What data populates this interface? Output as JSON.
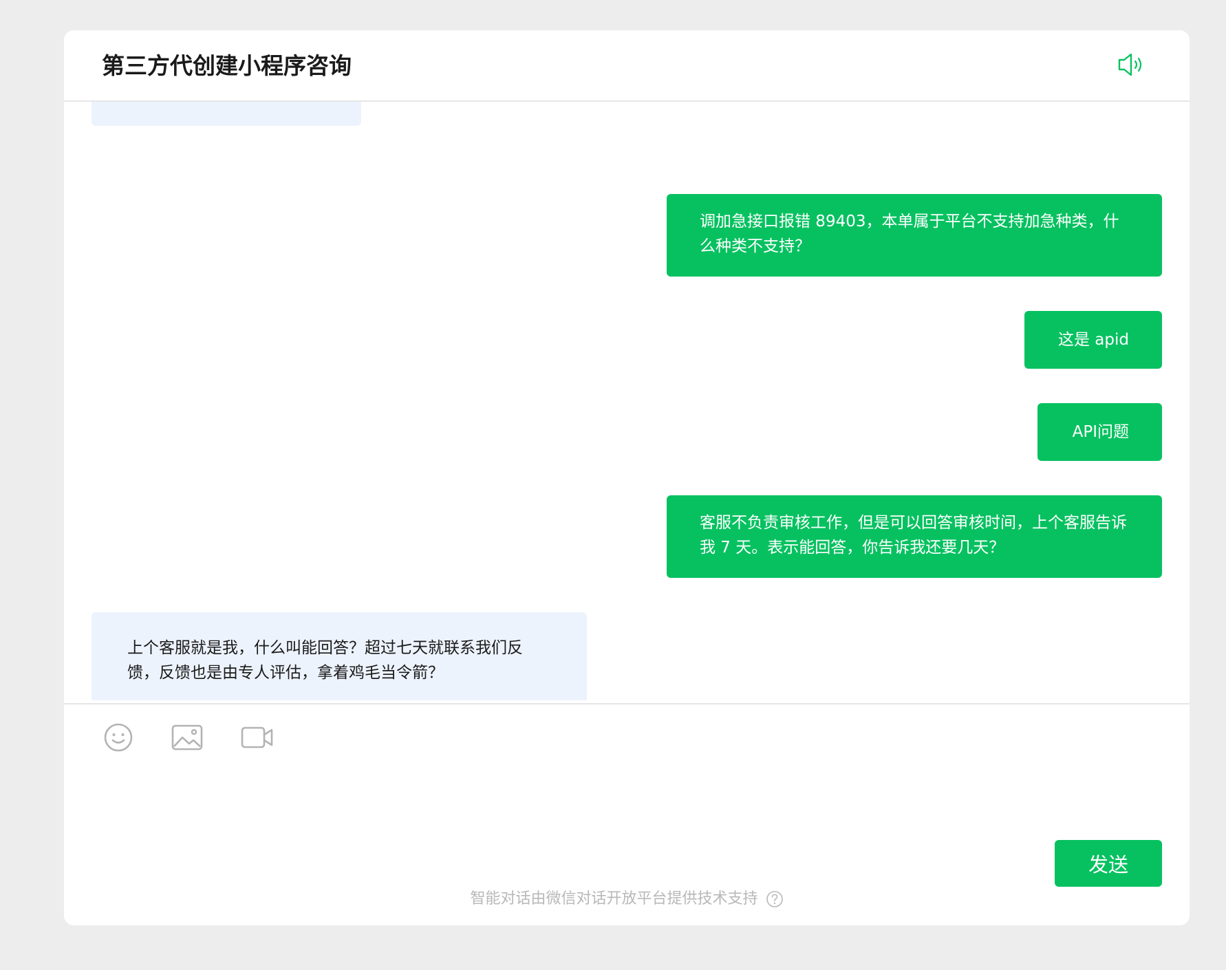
{
  "header": {
    "title": "第三方代创建小程序咨询",
    "speaker_icon": "speaker-icon"
  },
  "messages": [
    {
      "role": "user",
      "text": "调加急接口报错 89403，本单属于平台不支持加急种类，什么种类不支持？"
    },
    {
      "role": "user",
      "text": "这是 apid"
    },
    {
      "role": "user",
      "text": "API问题"
    },
    {
      "role": "user",
      "text": "客服不负责审核工作，但是可以回答审核时间，上个客服告诉我 7 天。表示能回答，你告诉我还要几天？"
    },
    {
      "role": "agent",
      "text": "上个客服就是我，什么叫能回答？超过七天就联系我们反馈，反馈也是由专人评估，拿着鸡毛当令箭？"
    }
  ],
  "toolbar": {
    "icons": [
      "emoji-icon",
      "image-icon",
      "video-icon"
    ]
  },
  "send_label": "发送",
  "footer_text": "智能对话由微信对话开放平台提供技术支持",
  "colors": {
    "accent": "#07c160",
    "agent_bubble": "#edf3fd",
    "background": "#ededed"
  }
}
